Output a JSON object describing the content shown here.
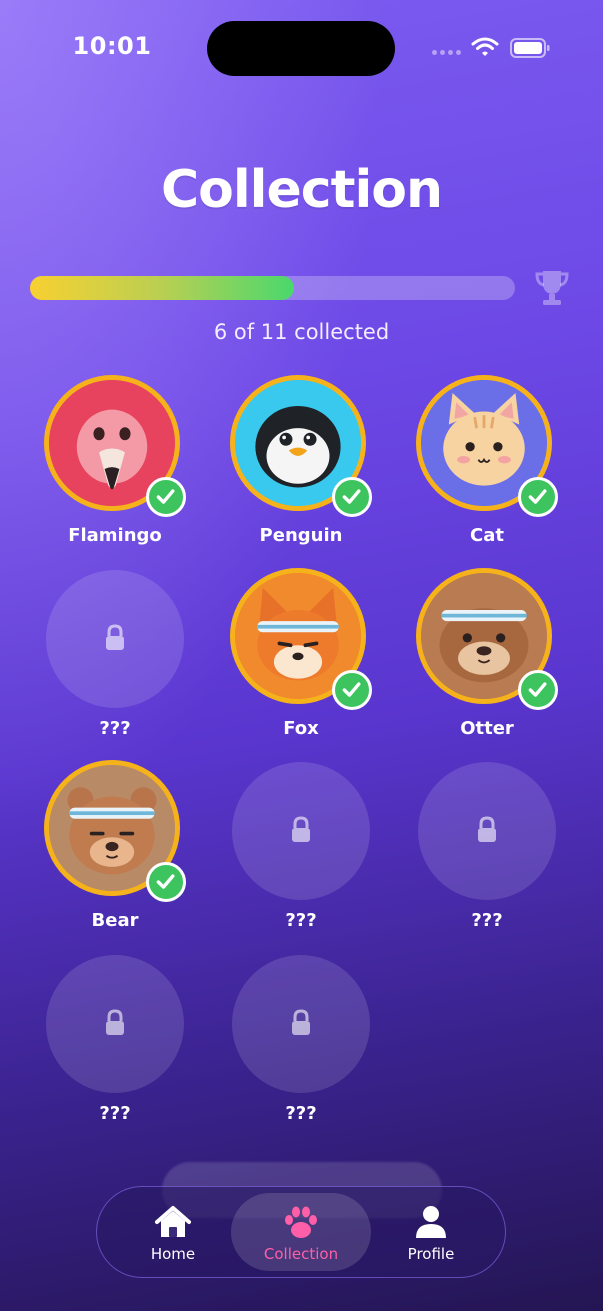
{
  "status_bar": {
    "time": "10:01"
  },
  "header": {
    "title": "Collection"
  },
  "progress": {
    "collected": 6,
    "total": 11,
    "fraction": 0.545,
    "text": "6 of 11 collected"
  },
  "grid": [
    {
      "label": "Flamingo",
      "collected": true,
      "icon": "flamingo-icon"
    },
    {
      "label": "Penguin",
      "collected": true,
      "icon": "penguin-icon"
    },
    {
      "label": "Cat",
      "collected": true,
      "icon": "cat-icon"
    },
    {
      "label": "???",
      "collected": false,
      "icon": "lock-icon"
    },
    {
      "label": "Fox",
      "collected": true,
      "icon": "fox-icon"
    },
    {
      "label": "Otter",
      "collected": true,
      "icon": "otter-icon"
    },
    {
      "label": "Bear",
      "collected": true,
      "icon": "bear-icon"
    },
    {
      "label": "???",
      "collected": false,
      "icon": "lock-icon"
    },
    {
      "label": "???",
      "collected": false,
      "icon": "lock-icon"
    },
    {
      "label": "???",
      "collected": false,
      "icon": "lock-icon"
    },
    {
      "label": "???",
      "collected": false,
      "icon": "lock-icon"
    }
  ],
  "tabbar": {
    "tabs": [
      {
        "label": "Home",
        "icon": "home-icon",
        "active": false
      },
      {
        "label": "Collection",
        "icon": "paw-icon",
        "active": true
      },
      {
        "label": "Profile",
        "icon": "person-icon",
        "active": false
      }
    ]
  },
  "colors": {
    "accent": "#ff5fa8",
    "check": "#3dc45e",
    "ring": "#f6b21a"
  }
}
